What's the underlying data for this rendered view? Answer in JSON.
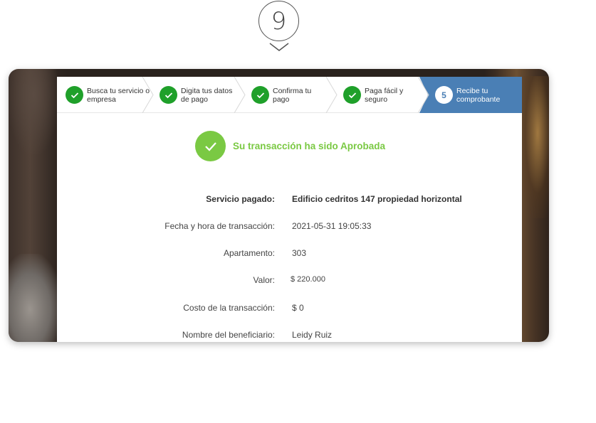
{
  "badge": {
    "number": "9"
  },
  "stepper": {
    "steps": [
      {
        "label": "Busca tu servicio o empresa",
        "state": "done"
      },
      {
        "label": "Digita tus datos de pago",
        "state": "done"
      },
      {
        "label": "Confirma tu pago",
        "state": "done"
      },
      {
        "label": "Paga fácil y seguro",
        "state": "done"
      },
      {
        "number": "5",
        "label": "Recibe tu comprobante",
        "state": "active"
      }
    ]
  },
  "status": {
    "message": "Su transacción ha sido Aprobada",
    "color": "#7ac943"
  },
  "details": [
    {
      "label": "Servicio pagado:",
      "value": "Edificio cedritos 147 propiedad horizontal"
    },
    {
      "label": "Fecha y hora de transacción:",
      "value": "2021-05-31 19:05:33"
    },
    {
      "label": "Apartamento:",
      "value": "303"
    },
    {
      "label": "Valor:",
      "value": "$ 220.000"
    },
    {
      "label": "Costo de la transacción:",
      "value": "$ 0"
    },
    {
      "label": "Nombre del beneficiario:",
      "value": "Leidy Ruiz"
    }
  ],
  "colors": {
    "step_done": "#1fa02a",
    "step_active": "#4a7fb5"
  }
}
